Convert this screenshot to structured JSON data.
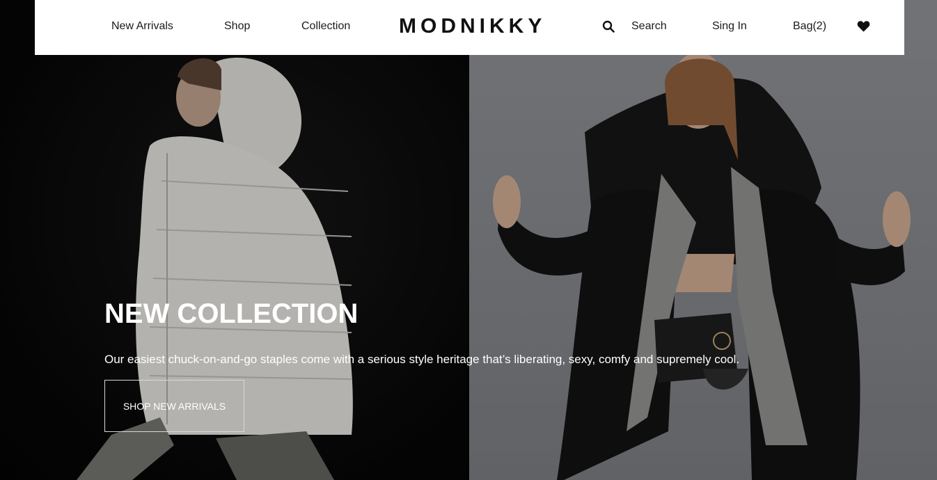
{
  "header": {
    "nav_left": [
      "New Arrivals",
      "Shop",
      "Collection"
    ],
    "logo": "MODNIKKY",
    "search_label": "Search",
    "signin_label": "Sing In",
    "bag_label": "Bag(2)",
    "search_icon": "search-icon",
    "wishlist_icon": "heart-icon"
  },
  "hero": {
    "title": "NEW COLLECTION",
    "subtitle": "Our easiest chuck-on-and-go staples come with a serious style heritage that’s liberating, sexy, comfy and supremely cool.",
    "cta_label": "SHOP NEW ARRIVALS"
  },
  "colors": {
    "header_bg": "#ffffff",
    "text_dark": "#1a1a1a",
    "hero_text": "#ffffff",
    "left_panel": "#080808",
    "right_panel": "#85878b"
  }
}
